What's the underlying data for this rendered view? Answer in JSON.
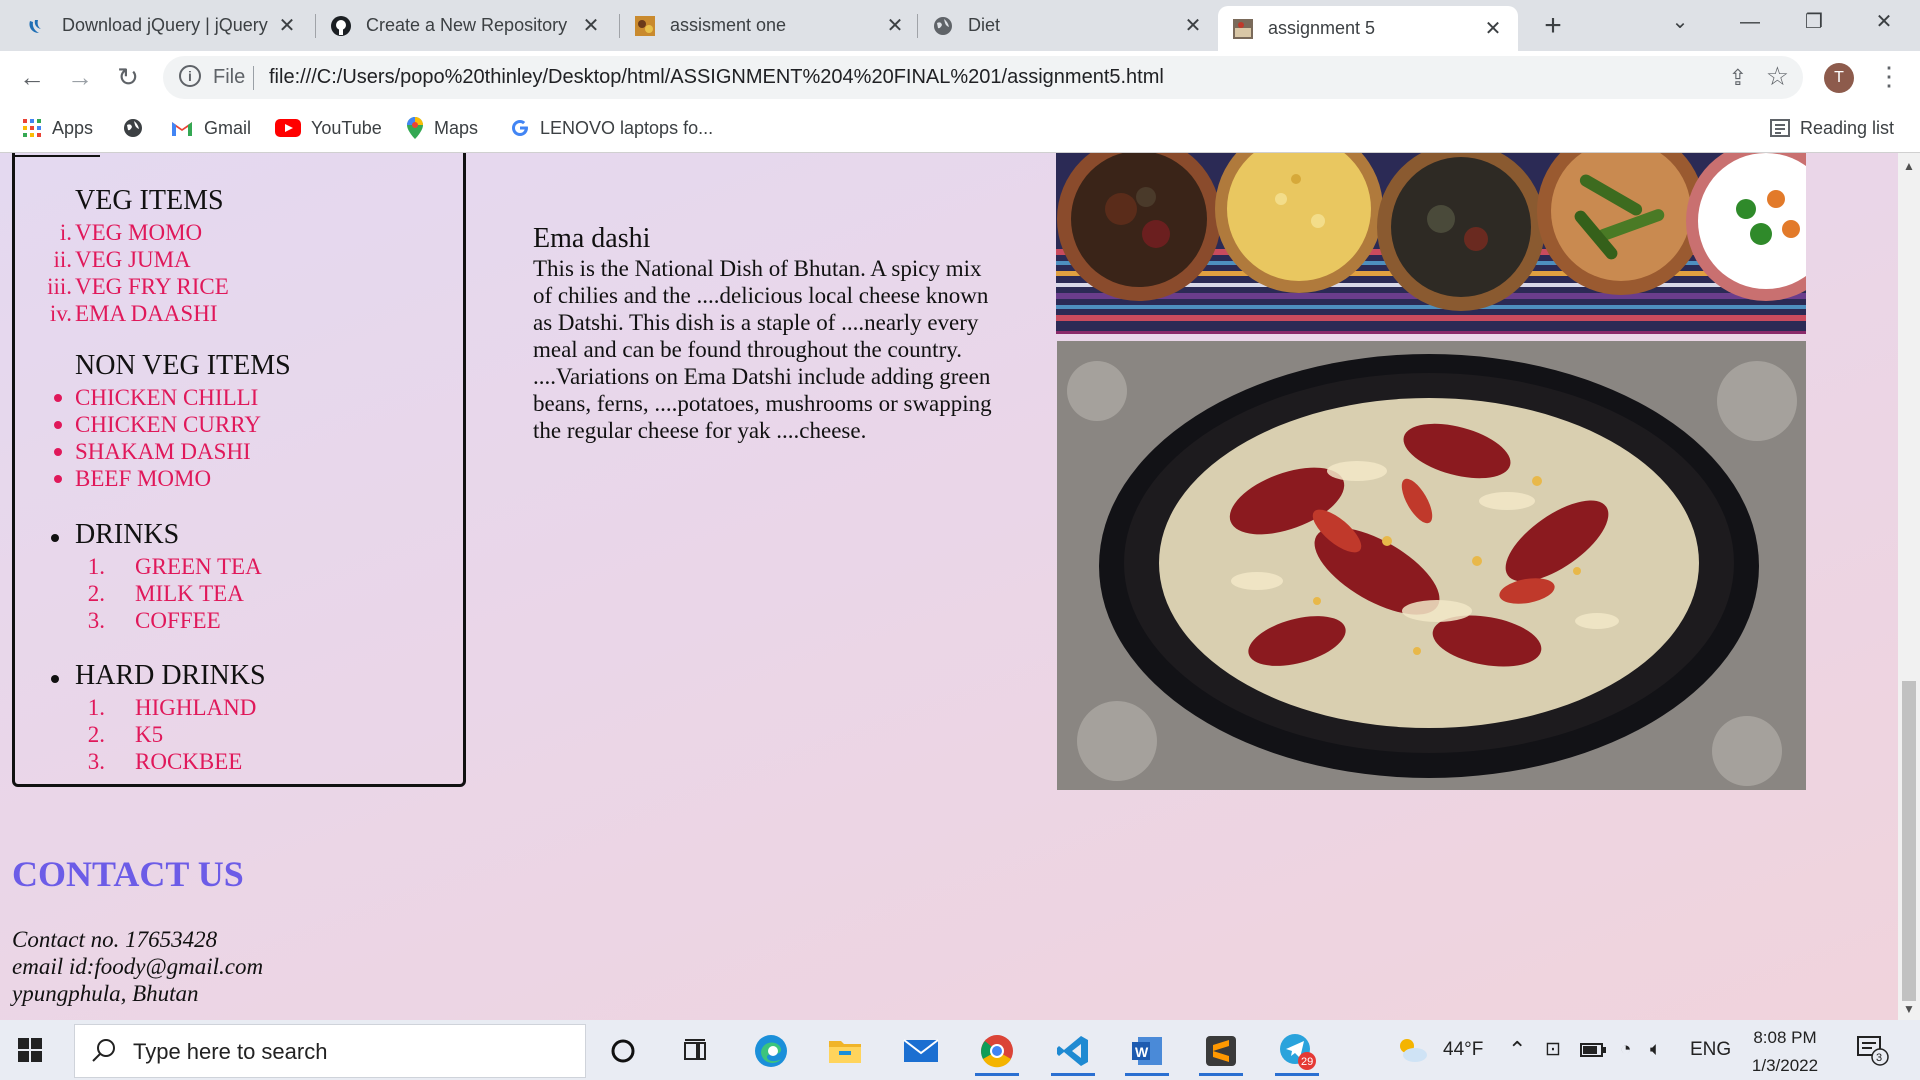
{
  "browser": {
    "tabs": [
      {
        "title": "Download jQuery | jQuery",
        "icon": "jquery-icon"
      },
      {
        "title": "Create a New Repository",
        "icon": "github-icon"
      },
      {
        "title": "assisment one",
        "icon": "image-thumbnail-icon"
      },
      {
        "title": "Diet",
        "icon": "globe-icon"
      },
      {
        "title": "assignment 5",
        "icon": "image-thumbnail-icon",
        "active": true
      }
    ],
    "address": {
      "scheme_label": "File",
      "url": "file:///C:/Users/popo%20thinley/Desktop/html/ASSIGNMENT%204%20FINAL%201/assignment5.html"
    },
    "profile_initial": "T",
    "bookmarks": [
      {
        "label": "Apps",
        "icon": "apps-grid-icon"
      },
      {
        "label": "",
        "icon": "globe-icon"
      },
      {
        "label": "Gmail",
        "icon": "gmail-icon"
      },
      {
        "label": "YouTube",
        "icon": "youtube-icon"
      },
      {
        "label": "Maps",
        "icon": "maps-pin-icon"
      },
      {
        "label": "LENOVO laptops fo...",
        "icon": "google-icon"
      }
    ],
    "reading_list": "Reading list"
  },
  "page": {
    "menu": {
      "veg": {
        "heading": "VEG ITEMS",
        "items": [
          "VEG MOMO",
          "VEG JUMA",
          "VEG FRY RICE",
          "EMA DAASHI"
        ],
        "markers": [
          "i.",
          "ii.",
          "iii.",
          "iv."
        ]
      },
      "nonveg": {
        "heading": "NON VEG ITEMS",
        "items": [
          "CHICKEN CHILLI",
          "CHICKEN CURRY",
          "SHAKAM DASHI",
          "BEEF MOMO"
        ]
      },
      "drinks": {
        "heading": "DRINKS",
        "items": [
          "GREEN TEA",
          "MILK TEA",
          "COFFEE"
        ],
        "markers": [
          "1.",
          "2.",
          "3."
        ]
      },
      "hard_drinks": {
        "heading": "HARD DRINKS",
        "items": [
          "HIGHLAND",
          "K5",
          "ROCKBEE"
        ],
        "markers": [
          "1.",
          "2.",
          "3."
        ]
      }
    },
    "dish": {
      "title": "Ema dashi",
      "description": "This is the National Dish of Bhutan. A spicy mix of chilies and the ....delicious local cheese known as Datshi. This dish is a staple of ....nearly every meal and can be found throughout the country. ....Variations on Ema Datshi include adding green beans, ferns, ....potatoes, mushrooms or swapping the regular cheese for yak ....cheese."
    },
    "contact": {
      "heading": "CONTACT US",
      "phone": "Contact no. 17653428",
      "email": "email id:foody@gmail.com",
      "address": "ypungphula, Bhutan"
    },
    "colors": {
      "item_text": "#e0185a",
      "contact_heading": "#6c5ce7"
    }
  },
  "taskbar": {
    "search_placeholder": "Type here to search",
    "weather": "44°F",
    "language": "ENG",
    "time": "8:08 PM",
    "date": "1/3/2022",
    "notification_count": "3",
    "telegram_badge": "29"
  }
}
